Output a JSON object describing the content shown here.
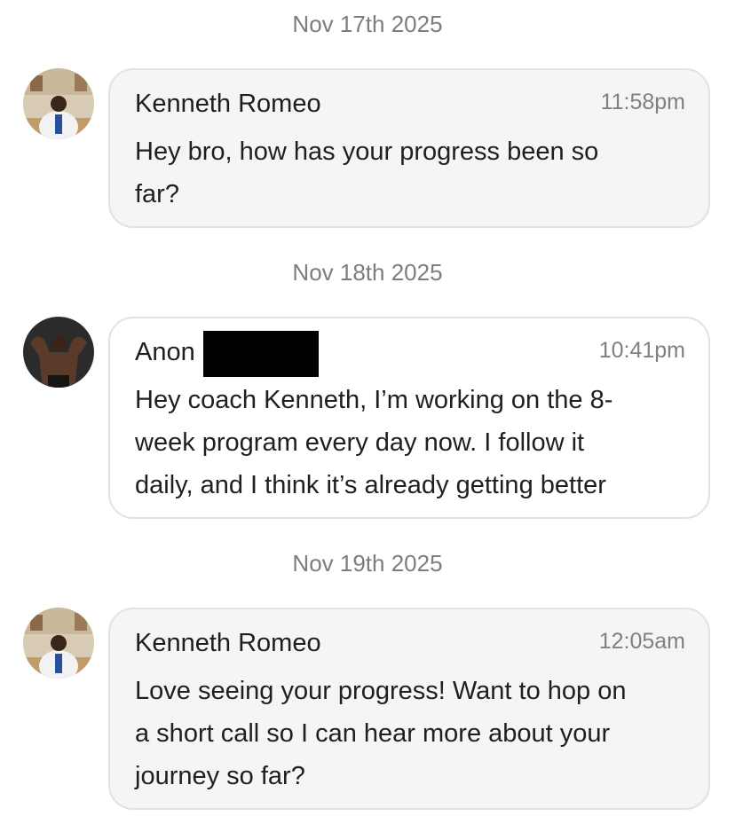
{
  "messages": [
    {
      "date": "Nov 17th 2025",
      "sender": "Kenneth Romeo",
      "time": "11:58pm",
      "text": "Hey bro, how has your progress been so\nfar?",
      "avatar": "coach-avatar"
    },
    {
      "date": "Nov 18th 2025",
      "sender": "Anon",
      "time": "10:41pm",
      "text": "Hey coach Kenneth, I’m working on the 8-\nweek program every day now. I follow it\ndaily, and I think it’s already getting better",
      "avatar": "user-avatar"
    },
    {
      "date": "Nov 19th 2025",
      "sender": "Kenneth Romeo",
      "time": "12:05am",
      "text": "Love seeing your progress! Want to hop on\na short call so I can hear more about your\njourney so far?",
      "avatar": "coach-avatar"
    }
  ],
  "colors": {
    "coach_bubble": "#f6f5f4",
    "user_bubble": "#ffffff",
    "border": "#e2e2e2",
    "meta_text": "#7d7d7d"
  }
}
